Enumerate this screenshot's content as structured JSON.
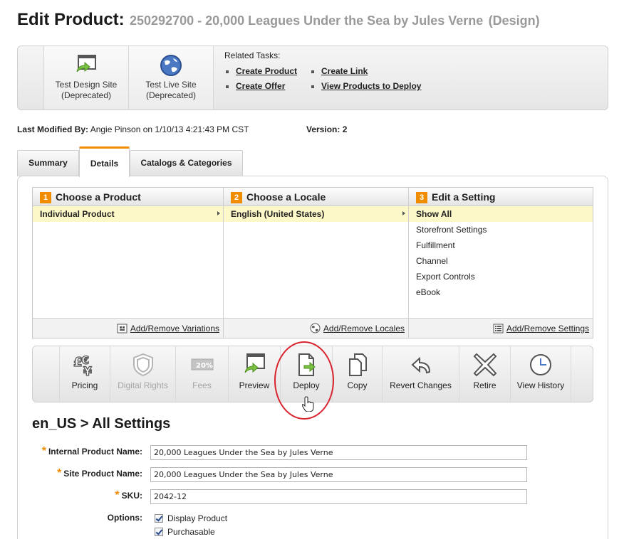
{
  "page": {
    "title": "Edit Product:",
    "subtitle": "250292700 - 20,000 Leagues Under the Sea by Jules Verne",
    "subtitle_suffix": "(Design)"
  },
  "top_panel": {
    "tiles": [
      {
        "label_line1": "Test Design Site",
        "label_line2": "(Deprecated)",
        "icon": "test-design-site-icon"
      },
      {
        "label_line1": "Test Live Site",
        "label_line2": "(Deprecated)",
        "icon": "globe-icon"
      }
    ],
    "related_title": "Related Tasks:",
    "related_col1": [
      "Create Product",
      "Create Offer"
    ],
    "related_col2": [
      "Create Link",
      "View Products to Deploy"
    ]
  },
  "meta": {
    "modified_label": "Last Modified By:",
    "modified_value": "Angie Pinson on 1/10/13 4:21:43 PM CST",
    "version_label": "Version:",
    "version_value": "2"
  },
  "tabs": [
    "Summary",
    "Details",
    "Catalogs & Categories"
  ],
  "active_tab": "Details",
  "columns": [
    {
      "num": "1",
      "title": "Choose a Product",
      "items": [
        "Individual Product"
      ],
      "selected": "Individual Product",
      "footer": "Add/Remove Variations",
      "footer_icon": "variations-icon"
    },
    {
      "num": "2",
      "title": "Choose a Locale",
      "items": [
        "English (United States)"
      ],
      "selected": "English (United States)",
      "footer": "Add/Remove Locales",
      "footer_icon": "globe-icon"
    },
    {
      "num": "3",
      "title": "Edit a Setting",
      "items": [
        "Show All",
        "Storefront Settings",
        "Fulfillment",
        "Channel",
        "Export Controls",
        "eBook"
      ],
      "selected": "Show All",
      "footer": "Add/Remove Settings",
      "footer_icon": "settings-list-icon"
    }
  ],
  "toolbar": [
    {
      "label": "Pricing",
      "icon": "pricing-currency-icon",
      "enabled": true
    },
    {
      "label": "Digital Rights",
      "icon": "shield-icon",
      "enabled": false
    },
    {
      "label": "Fees",
      "icon": "fees-icon",
      "enabled": false
    },
    {
      "label": "Preview",
      "icon": "preview-icon",
      "enabled": true
    },
    {
      "label": "Deploy",
      "icon": "deploy-icon",
      "enabled": true
    },
    {
      "label": "Copy",
      "icon": "copy-icon",
      "enabled": true
    },
    {
      "label": "Revert Changes",
      "icon": "revert-icon",
      "enabled": true
    },
    {
      "label": "Retire",
      "icon": "retire-x-icon",
      "enabled": true
    },
    {
      "label": "View History",
      "icon": "clock-icon",
      "enabled": true
    }
  ],
  "section": {
    "title": "en_US > All Settings"
  },
  "form": {
    "internal_name_label": "Internal Product Name:",
    "internal_name_value": "20,000 Leagues Under the Sea by Jules Verne",
    "site_name_label": "Site Product Name:",
    "site_name_value": "20,000 Leagues Under the Sea by Jules Verne",
    "sku_label": "SKU:",
    "sku_value": "2042-12",
    "options_label": "Options:",
    "options": [
      "Display Product",
      "Purchasable"
    ]
  },
  "colors": {
    "accent": "#f08c00",
    "highlight": "#d9232e",
    "selected_row": "#fdf8c8"
  }
}
